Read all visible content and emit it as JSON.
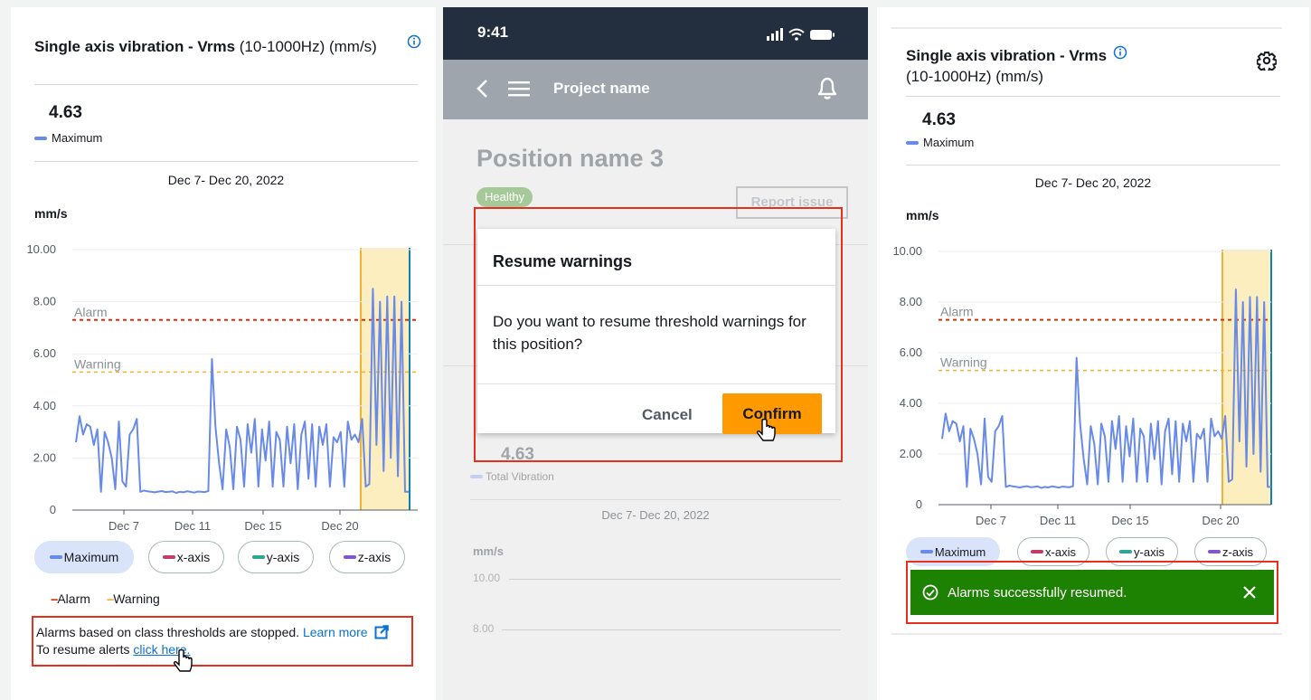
{
  "panel1": {
    "title_bold": "Single axis vibration - Vrms",
    "title_rest": " (10-1000Hz) (mm/s)",
    "info_icon": "info-circle-icon",
    "value": "4.63",
    "value_label": "Maximum",
    "date_range": "Dec 7- Dec 20, 2022",
    "unit": "mm/s",
    "filters": [
      "Maximum",
      "x-axis",
      "y-axis",
      "z-axis"
    ],
    "alarm_legend": "Alarm",
    "warning_legend": "Warning",
    "notice_line1": "Alarms based on class thresholds are stopped.",
    "learn_more": "Learn more",
    "notice_line2": "To resume alerts",
    "click_here": "click here."
  },
  "chart": {
    "y_ticks": [
      "10.00",
      "8.00",
      "6.00",
      "4.00",
      "2.00",
      "0"
    ],
    "x_ticks": [
      "Dec 7",
      "Dec 11",
      "Dec 15",
      "Dec 20"
    ],
    "alarm_label": "Alarm",
    "warning_label": "Warning",
    "alarm_value": 7.3,
    "warning_value": 5.3
  },
  "chart_data": {
    "type": "line",
    "title": "Single axis vibration - Vrms (10-1000Hz) (mm/s)",
    "ylabel": "mm/s",
    "ylim": [
      0,
      10
    ],
    "x_ticks": [
      "Dec 7",
      "Dec 11",
      "Dec 15",
      "Dec 20"
    ],
    "series": [
      {
        "name": "Maximum",
        "values": [
          2.6,
          3.6,
          2.9,
          3.3,
          3.2,
          2.5,
          3.1,
          0.7,
          3.0,
          2.6,
          2.0,
          0.8,
          3.4,
          1.1,
          0.9,
          2.9,
          3.1,
          3.5,
          0.7,
          0.75,
          0.72,
          0.7,
          0.68,
          0.71,
          0.73,
          0.69,
          0.7,
          0.72,
          0.66,
          0.7,
          0.68,
          0.72,
          0.7,
          0.67,
          0.71,
          0.7,
          0.69,
          0.73,
          5.8,
          3.2,
          1.8,
          0.8,
          3.1,
          2.4,
          0.8,
          3.2,
          2.7,
          0.9,
          3.3,
          2.2,
          3.5,
          0.9,
          3.1,
          1.9,
          3.4,
          0.9,
          3.0,
          2.7,
          0.9,
          3.2,
          1.8,
          3.3,
          0.8,
          2.9,
          3.4,
          1.2,
          3.3,
          0.9,
          3.2,
          2.5,
          3.3,
          0.9,
          2.8,
          2.6,
          3.0,
          0.9,
          3.4,
          2.7,
          2.9,
          2.6,
          3.5,
          0.9,
          1.0,
          8.5,
          2.5,
          8.0,
          1.5,
          8.2,
          2.0,
          8.2,
          1.3,
          8.0,
          0.7,
          0.7
        ]
      }
    ],
    "thresholds": [
      {
        "name": "Alarm",
        "value": 7.3
      },
      {
        "name": "Warning",
        "value": 5.3
      }
    ],
    "highlighted_range": "Dec 20 to end",
    "legend_placement": "bottom",
    "colors": {
      "maximum": "#688ae8",
      "alarm": "#d13212",
      "warning": "#f2b134",
      "highlight": "#fdeebf"
    }
  },
  "phone": {
    "time": "9:41",
    "back_icon": "chevron-left-icon",
    "menu_icon": "hamburger-icon",
    "project_name": "Project name",
    "bell_icon": "bell-icon",
    "position_name": "Position name 3",
    "status_badge": "Healthy",
    "report_issue": "Report issue",
    "dialog_title": "Resume warnings",
    "dialog_body": "Do you want to resume threshold warnings for this position?",
    "cancel": "Cancel",
    "confirm": "Confirm",
    "bg_value": "4.63",
    "bg_value_label": "Total Vibration",
    "bg_date_range": "Dec 7- Dec 20, 2022",
    "bg_unit": "mm/s",
    "bg_y1": "10.00",
    "bg_y2": "8.00"
  },
  "panel3": {
    "title_bold": "Single axis vibration - Vrms",
    "title_rest": "(10-1000Hz) (mm/s)",
    "settings_icon": "gear-icon",
    "value": "4.63",
    "value_label": "Maximum",
    "date_range": "Dec 7- Dec 20, 2022",
    "unit": "mm/s",
    "filters": [
      "Maximum",
      "x-axis",
      "y-axis",
      "z-axis"
    ],
    "toast": "Alarms successfully resumed.",
    "toast_close": "close-icon"
  },
  "colors": {
    "accent": "#0972d3",
    "alarm": "#d13212",
    "warning": "#f2b134",
    "confirm": "#ff9900",
    "success": "#1d8102",
    "callout": "#e4301d"
  }
}
